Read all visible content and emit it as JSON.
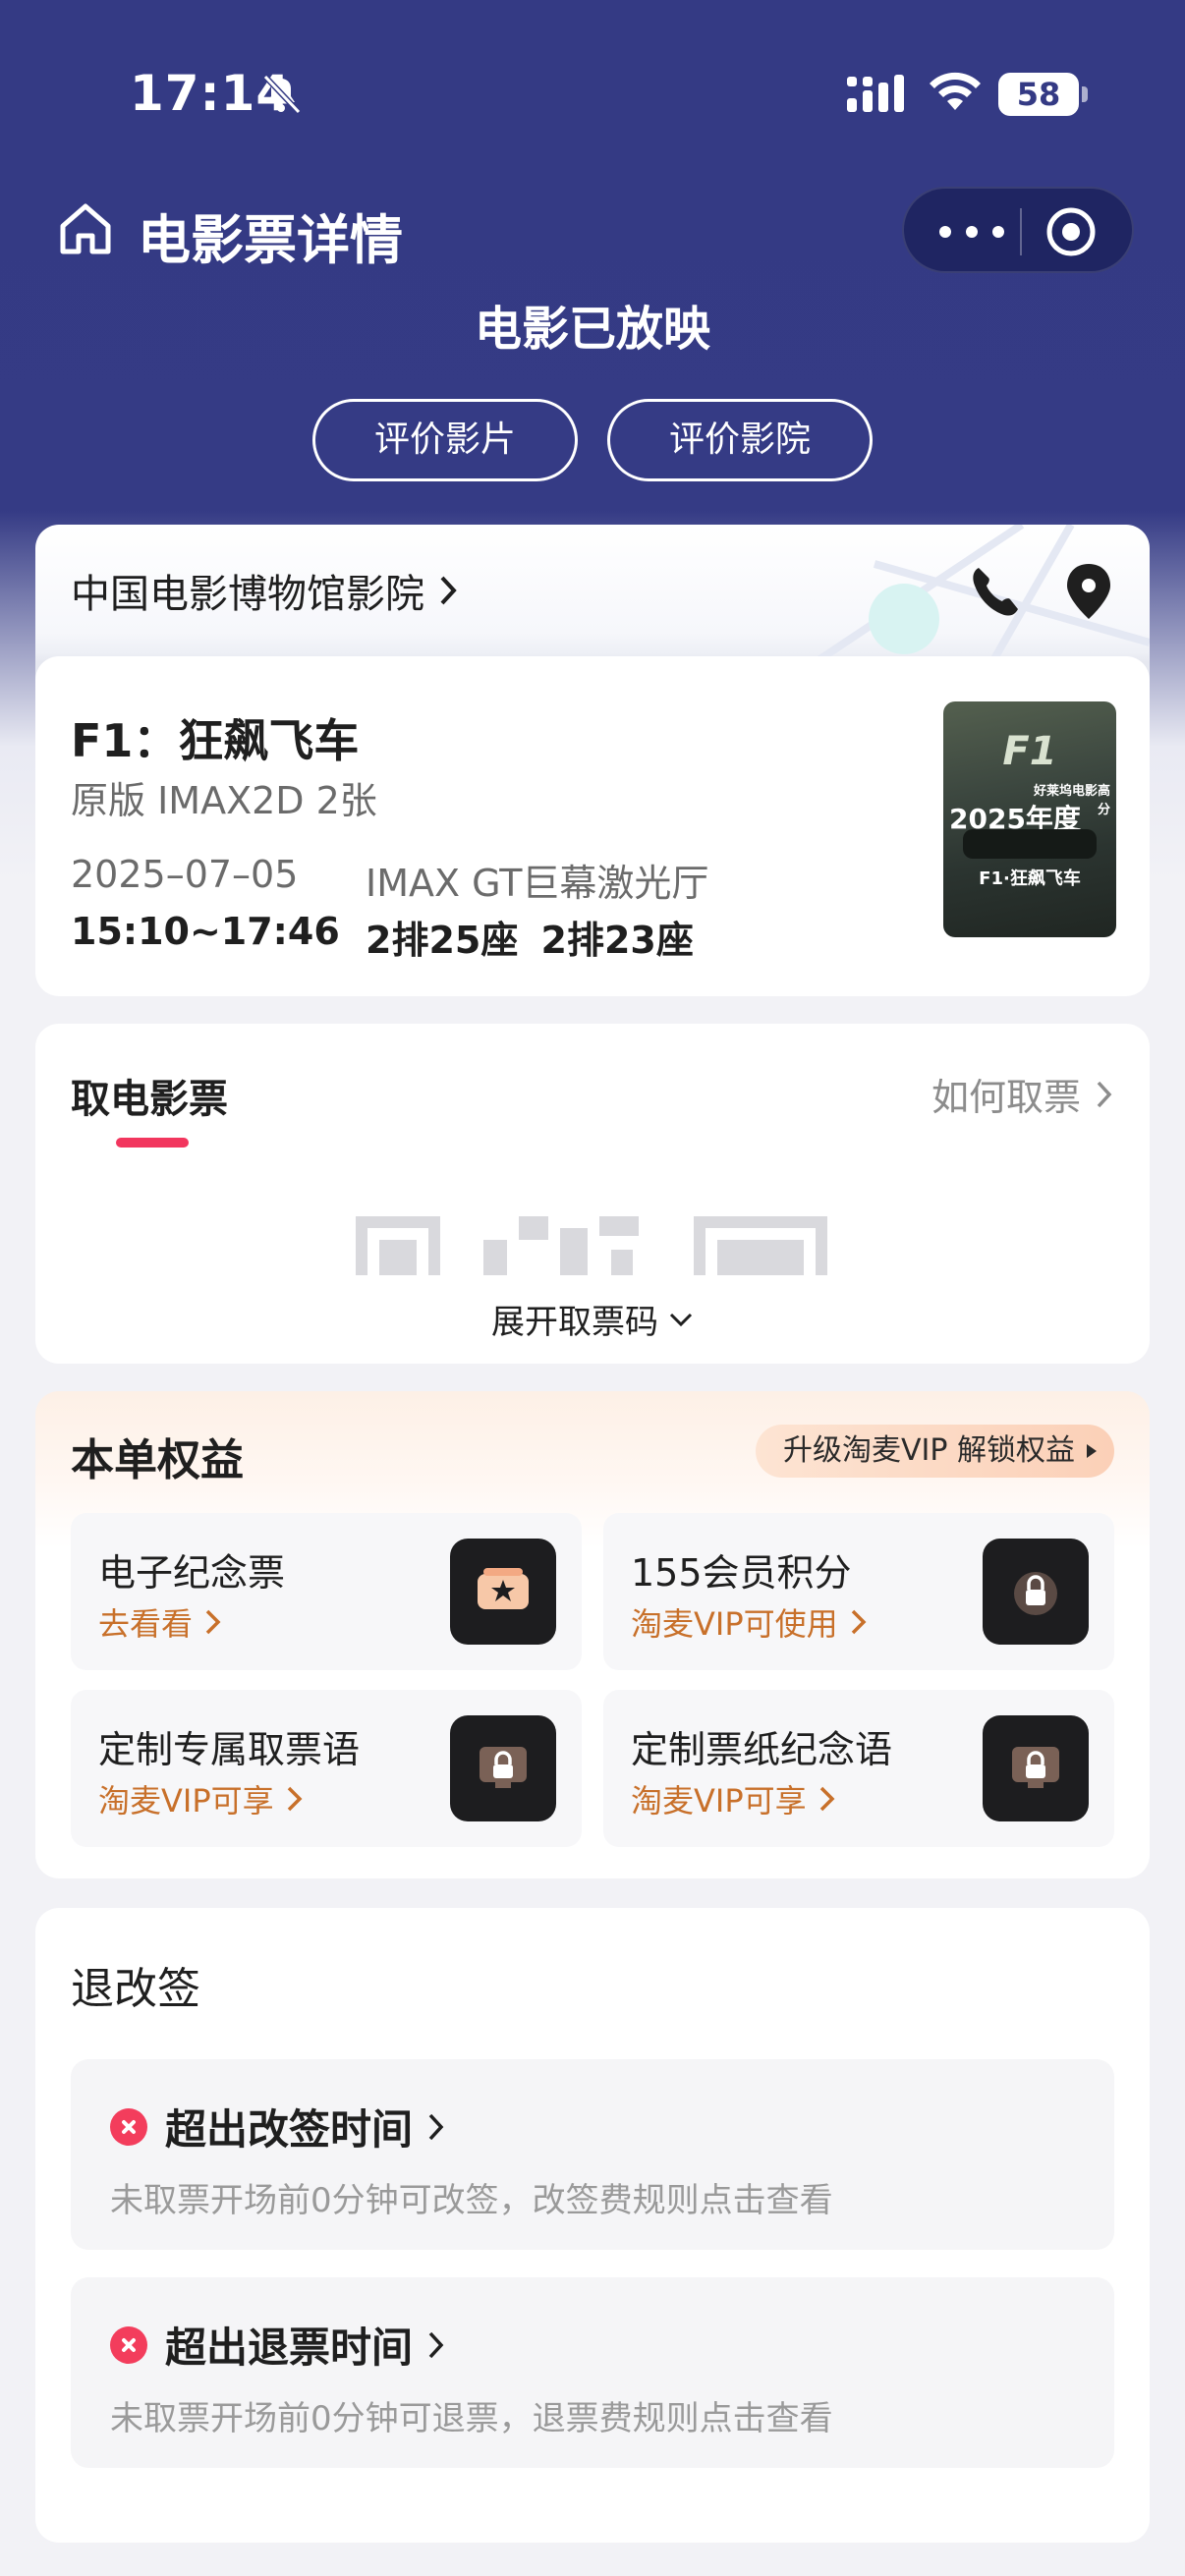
{
  "status_bar": {
    "time": "17:14",
    "battery": "58"
  },
  "nav": {
    "title": "电影票详情"
  },
  "order_status": "电影已放映",
  "actions": {
    "rate_movie": "评价影片",
    "rate_cinema": "评价影院"
  },
  "cinema": {
    "name": "中国电影博物馆影院"
  },
  "movie": {
    "title": "F1：狂飙飞车",
    "format": "原版 IMAX2D 2张",
    "date": "2025–07–05",
    "time": "15:10~17:46",
    "hall": "IMAX GT巨幕激光厅",
    "seats": "2排25座  2排23座",
    "poster": {
      "top": "F1",
      "year": "2025年度",
      "award": "好莱坞电影高分",
      "name": "F1·狂飙飞车"
    }
  },
  "ticket": {
    "title": "取电影票",
    "how_to": "如何取票",
    "expand": "展开取票码"
  },
  "benefits": {
    "title": "本单权益",
    "vip_pill": "升级淘麦VIP 解锁权益",
    "items": [
      {
        "name": "电子纪念票",
        "action": "去看看",
        "icon": "ticket-star-icon"
      },
      {
        "name": "155会员积分",
        "action": "淘麦VIP可使用",
        "icon": "lock-icon"
      },
      {
        "name": "定制专属取票语",
        "action": "淘麦VIP可享",
        "icon": "lock-icon"
      },
      {
        "name": "定制票纸纪念语",
        "action": "淘麦VIP可享",
        "icon": "lock-icon"
      }
    ]
  },
  "refund": {
    "title": "退改签",
    "items": [
      {
        "title": "超出改签时间",
        "desc": "未取票开场前0分钟可改签，改签费规则点击查看"
      },
      {
        "title": "超出退票时间",
        "desc": "未取票开场前0分钟可退票，退票费规则点击查看"
      }
    ]
  },
  "colors": {
    "header": "#343a84",
    "accent": "#f2365e",
    "vip_text": "#c8702a"
  }
}
